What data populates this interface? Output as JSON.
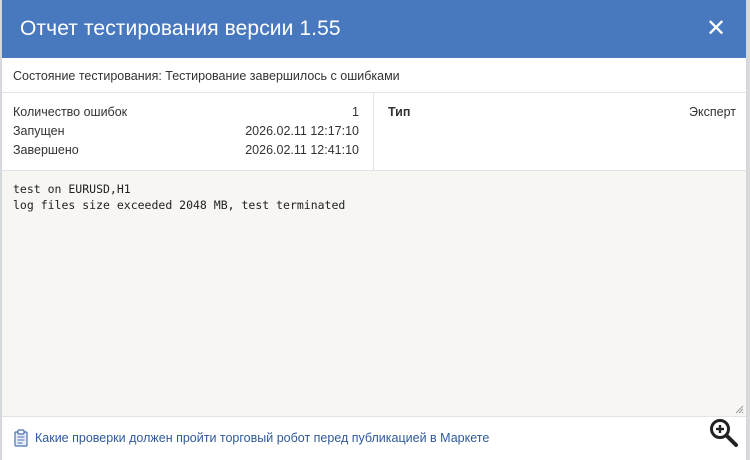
{
  "dialog": {
    "title": "Отчет тестирования версии 1.55",
    "close_glyph": "✕",
    "status_text": "Состояние тестирования: Тестирование завершилось с ошибками"
  },
  "info": {
    "rows": [
      {
        "label": "Количество ошибок",
        "value": "1"
      },
      {
        "label": "Запущен",
        "value": "2026.02.11 12:17:10"
      },
      {
        "label": "Завершено",
        "value": "2026.02.11 12:41:10"
      }
    ],
    "type_label": "Тип",
    "type_value": "Эксперт"
  },
  "log": {
    "lines": [
      "test on EURUSD,H1",
      "log files size exceeded 2048 MB, test terminated"
    ]
  },
  "footer": {
    "link_text": "Какие проверки должен пройти торговый робот перед публикацией в Маркете",
    "icon": "clipboard-icon",
    "zoom_icon": "zoom-in-icon"
  },
  "colors": {
    "header_bg": "#4878bd",
    "link": "#2e5a9e",
    "log_bg": "#f7f6f2"
  }
}
